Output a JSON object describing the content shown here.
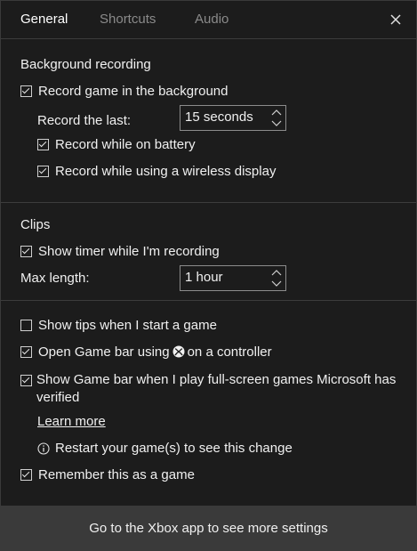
{
  "tabs": {
    "general": "General",
    "shortcuts": "Shortcuts",
    "audio": "Audio"
  },
  "background": {
    "title": "Background recording",
    "record_bg": "Record game in the background",
    "record_last_label": "Record the last:",
    "record_last_value": "15 seconds",
    "battery": "Record while on battery",
    "wireless": "Record while using a wireless display"
  },
  "clips": {
    "title": "Clips",
    "timer": "Show timer while I'm recording",
    "max_length_label": "Max length:",
    "max_length_value": "1 hour"
  },
  "misc": {
    "tips": "Show tips when I start a game",
    "open_bar_pre": "Open Game bar using",
    "open_bar_post": "on a controller",
    "fullscreen": "Show Game bar when I play full-screen games Microsoft has verified",
    "learn_more": "Learn more",
    "restart_note": "Restart your game(s) to see this change",
    "remember": "Remember this as a game"
  },
  "footer": {
    "label": "Go to the Xbox app to see more settings"
  },
  "checks": {
    "record_bg": true,
    "battery": true,
    "wireless": true,
    "timer": true,
    "tips": false,
    "open_bar": true,
    "fullscreen": true,
    "remember": true
  }
}
